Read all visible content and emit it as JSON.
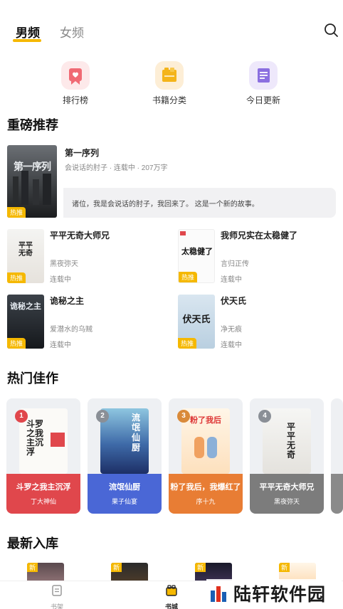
{
  "tabs": [
    {
      "label": "男频",
      "active": true
    },
    {
      "label": "女频",
      "active": false
    }
  ],
  "search_icon": "search-icon",
  "accent": "#f5b800",
  "quick_links": [
    {
      "label": "排行榜",
      "icon": "ranking-icon",
      "bg": "#fde9ea",
      "fg": "#f06a74"
    },
    {
      "label": "书籍分类",
      "icon": "category-icon",
      "bg": "#fdeed6",
      "fg": "#f4b41a"
    },
    {
      "label": "今日更新",
      "icon": "update-icon",
      "bg": "#eee8fb",
      "fg": "#8b6fe0"
    }
  ],
  "sections": {
    "featured": "重磅推荐",
    "hot": "热门佳作",
    "new": "最新入库"
  },
  "hot_tag": "热推",
  "new_tag": "新",
  "feature": {
    "title": "第一序列",
    "meta": "会说话的肘子 · 连载中 · 207万字",
    "desc": "诸位，我是会说话的肘子，我回来了。 这是一个新的故事。",
    "cover_text": "第一序列"
  },
  "books": [
    {
      "title": "平平无奇大师兄",
      "author": "黑夜弥天",
      "status": "连载中",
      "cover_text": "平平无奇"
    },
    {
      "title": "我师兄实在太稳健了",
      "author": "言归正传",
      "status": "连载中",
      "cover_text": "太稳健了"
    },
    {
      "title": "诡秘之主",
      "author": "爱潜水的乌贼",
      "status": "连载中",
      "cover_text": "诡秘之主"
    },
    {
      "title": "伏天氏",
      "author": "净无痕",
      "status": "连载中",
      "cover_text": "伏天氏"
    }
  ],
  "hot_books": [
    {
      "rank": "1",
      "title": "斗罗之我主沉浮",
      "author": "丁大神仙",
      "band": "#e0474c",
      "cover_text": "斗罗之我主沉浮"
    },
    {
      "rank": "2",
      "title": "流氓仙厨",
      "author": "果子仙宴",
      "band": "#4a67d6",
      "cover_text": "流氓仙厨"
    },
    {
      "rank": "3",
      "title": "粉了我后，我爆红了",
      "author": "序十九",
      "band": "#e87d34",
      "cover_text": "粉了我后"
    },
    {
      "rank": "4",
      "title": "平平无奇大师兄",
      "author": "黑夜弥天",
      "band": "#7c7c7c",
      "cover_text": "平平无奇"
    }
  ],
  "bottom_nav": [
    {
      "label": "书架",
      "icon": "bookshelf-icon",
      "active": false
    },
    {
      "label": "书城",
      "icon": "bookstore-icon",
      "active": true
    }
  ],
  "watermark": "陆轩软件园"
}
